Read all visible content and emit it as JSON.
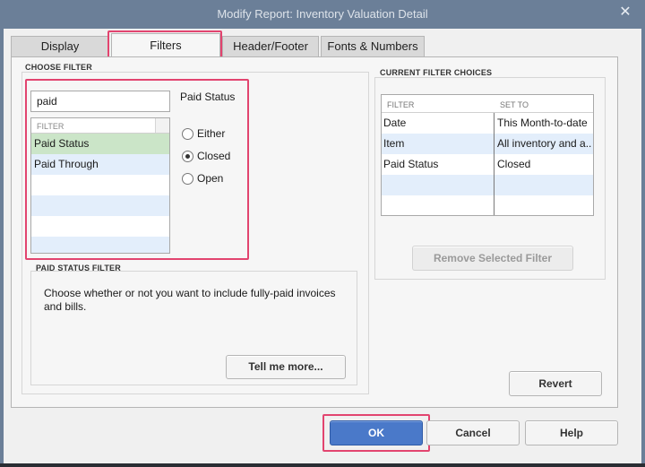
{
  "window": {
    "title": "Modify Report: Inventory Valuation Detail",
    "close_glyph": "✕"
  },
  "tabs": [
    {
      "label": "Display"
    },
    {
      "label": "Filters",
      "active": true
    },
    {
      "label": "Header/Footer"
    },
    {
      "label": "Fonts & Numbers"
    }
  ],
  "choose_filter": {
    "section_label": "CHOOSE FILTER",
    "search_value": "paid",
    "list_header": "FILTER",
    "items": [
      "Paid Status",
      "Paid Through"
    ]
  },
  "paid_status": {
    "label": "Paid Status",
    "options": [
      {
        "label": "Either",
        "selected": false
      },
      {
        "label": "Closed",
        "selected": true
      },
      {
        "label": "Open",
        "selected": false
      }
    ]
  },
  "paid_status_filter": {
    "section_label": "PAID STATUS FILTER",
    "description": "Choose whether or not you want to include fully-paid invoices and bills.",
    "tell_me_more": "Tell me more..."
  },
  "current_filters": {
    "section_label": "CURRENT FILTER CHOICES",
    "col_filter": "FILTER",
    "col_set_to": "SET TO",
    "rows": [
      {
        "filter": "Date",
        "set_to": "This Month-to-date"
      },
      {
        "filter": "Item",
        "set_to": "All inventory and a..."
      },
      {
        "filter": "Paid Status",
        "set_to": "Closed"
      }
    ],
    "remove_button": "Remove Selected Filter"
  },
  "buttons": {
    "revert": "Revert",
    "ok": "OK",
    "cancel": "Cancel",
    "help": "Help"
  },
  "colors": {
    "highlight": "#e2446f",
    "primary_button": "#4a79c9",
    "selected_row": "#cbe5c8",
    "alt_row": "#e3eefb"
  }
}
